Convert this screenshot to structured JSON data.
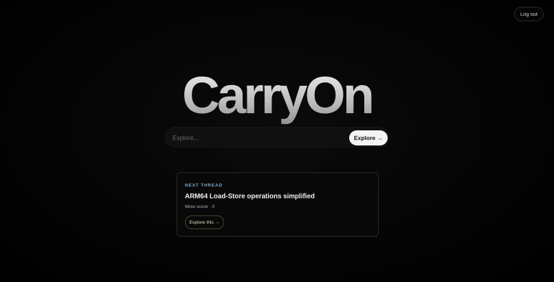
{
  "header": {
    "logout_label": "Log out"
  },
  "hero": {
    "brand": "CarryOn"
  },
  "search": {
    "placeholder": "Explore...",
    "value": "",
    "button_label": "Explore →"
  },
  "next_thread": {
    "eyebrow": "NEXT THREAD",
    "title": "ARM64 Load-Store operations simplified",
    "score": "Wow score · 0",
    "button_label": "Explore this →"
  },
  "colors": {
    "background": "#000000",
    "eyebrow": "#7fa9c8",
    "card_border": "#2c2a1e",
    "button_light": "#f4f4f4"
  }
}
